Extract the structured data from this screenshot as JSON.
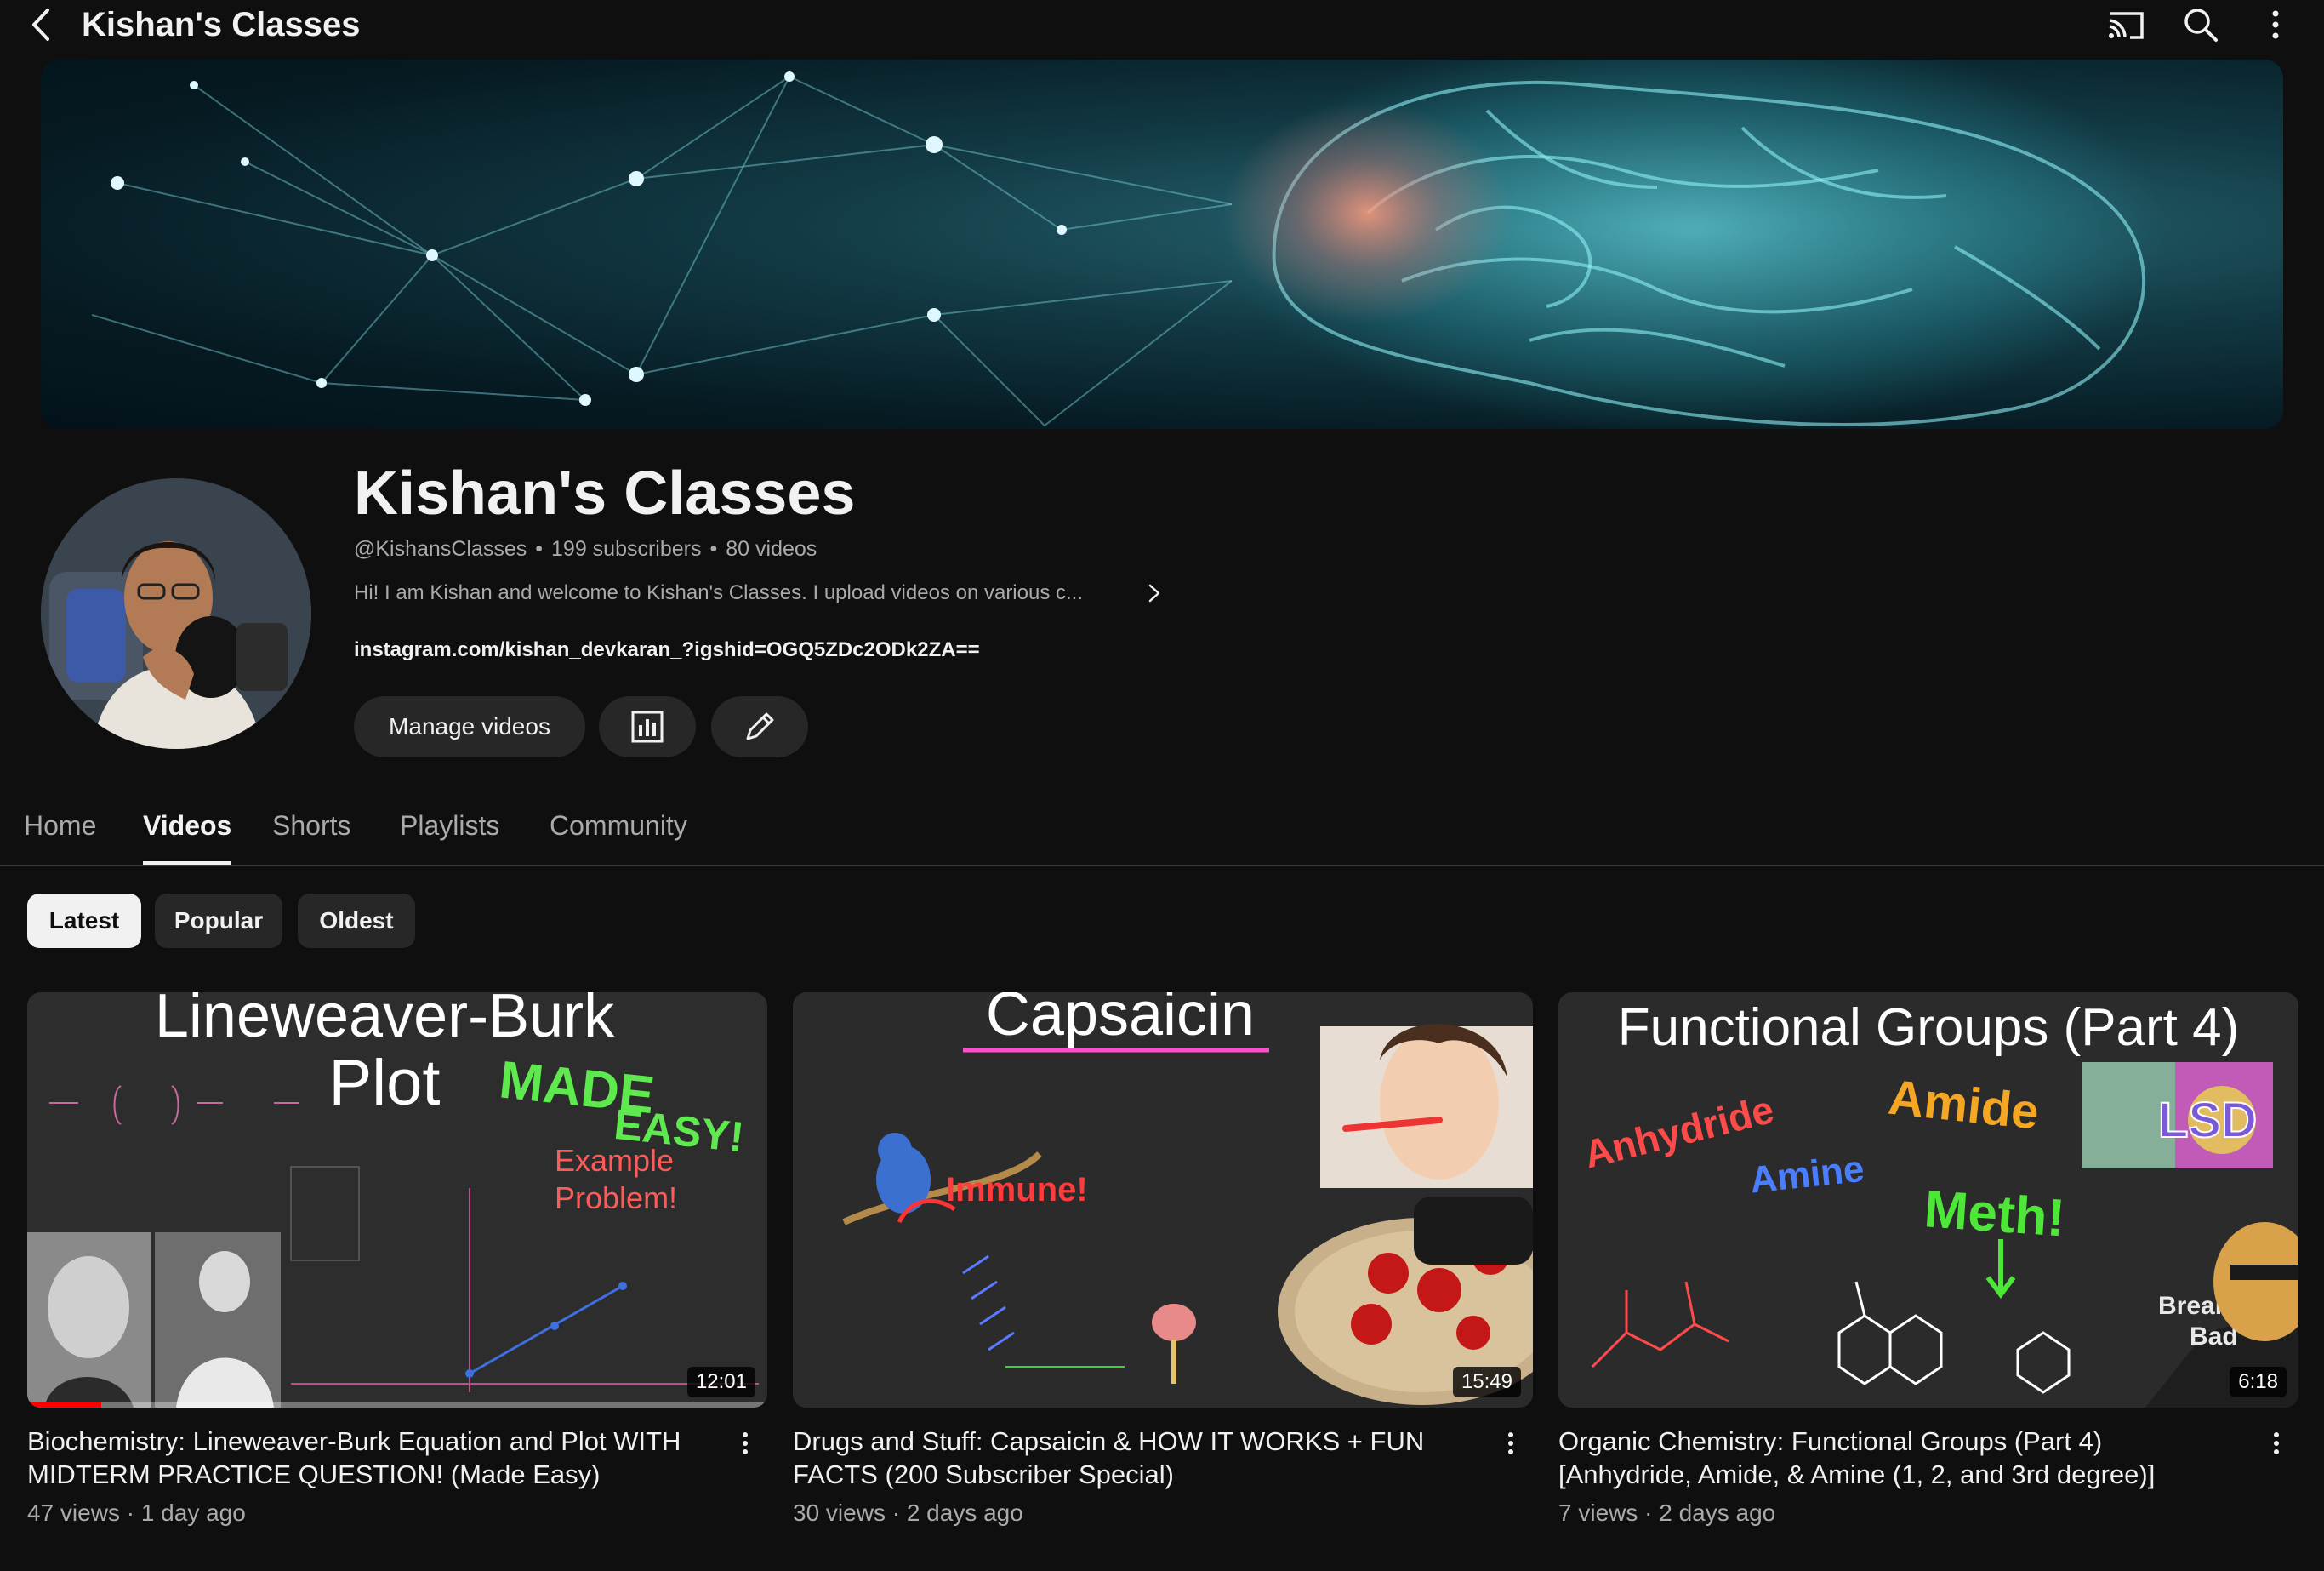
{
  "top_bar": {
    "title": "Kishan's Classes",
    "icons": [
      "back-icon",
      "cast-icon",
      "search-icon",
      "more-vert-icon"
    ]
  },
  "channel": {
    "name": "Kishan's Classes",
    "handle": "@KishansClasses",
    "subscribers": "199 subscribers",
    "videos": "80 videos",
    "separator": "•",
    "description": "Hi!  I am Kishan and welcome to Kishan's Classes.  I upload videos on various c...",
    "link": "instagram.com/kishan_devkaran_?igshid=OGQ5ZDc2ODk2ZA==",
    "buttons": {
      "manage": "Manage videos",
      "analytics_icon": "analytics-icon",
      "edit_icon": "pencil-icon"
    }
  },
  "tabs": [
    {
      "label": "Home",
      "active": false
    },
    {
      "label": "Videos",
      "active": true
    },
    {
      "label": "Shorts",
      "active": false
    },
    {
      "label": "Playlists",
      "active": false
    },
    {
      "label": "Community",
      "active": false
    }
  ],
  "sort_chips": [
    {
      "label": "Latest",
      "active": true
    },
    {
      "label": "Popular",
      "active": false
    },
    {
      "label": "Oldest",
      "active": false
    }
  ],
  "videos": [
    {
      "title": "Biochemistry: Lineweaver-Burk Equation and Plot WITH MIDTERM PRACTICE QUESTION! (Made Easy)",
      "meta": "47 views · 1 day ago",
      "duration": "12:01",
      "watch_progress": 0.1,
      "thumb": {
        "line1": "Lineweaver-Burk",
        "line2": "Plot",
        "made": "MADE",
        "easy": "EASY!",
        "example1": "Example",
        "example2": "Problem!"
      }
    },
    {
      "title": "Drugs and Stuff: Capsaicin & HOW IT WORKS + FUN FACTS (200 Subscriber Special)",
      "meta": "30 views · 2 days ago",
      "duration": "15:49",
      "thumb": {
        "heading": "Capsaicin",
        "immune": "Immune!"
      }
    },
    {
      "title": "Organic Chemistry: Functional Groups (Part 4) [Anhydride, Amide, & Amine (1, 2, and 3rd degree)]",
      "meta": "7 views · 2 days ago",
      "duration": "6:18",
      "thumb": {
        "heading": "Functional Groups (Part 4)",
        "anhydride": "Anhydride",
        "amide": "Amide",
        "amine": "Amine",
        "meth": "Meth!",
        "lsd": "LSD",
        "breaking": "Breaking",
        "bad": "Bad"
      }
    }
  ]
}
